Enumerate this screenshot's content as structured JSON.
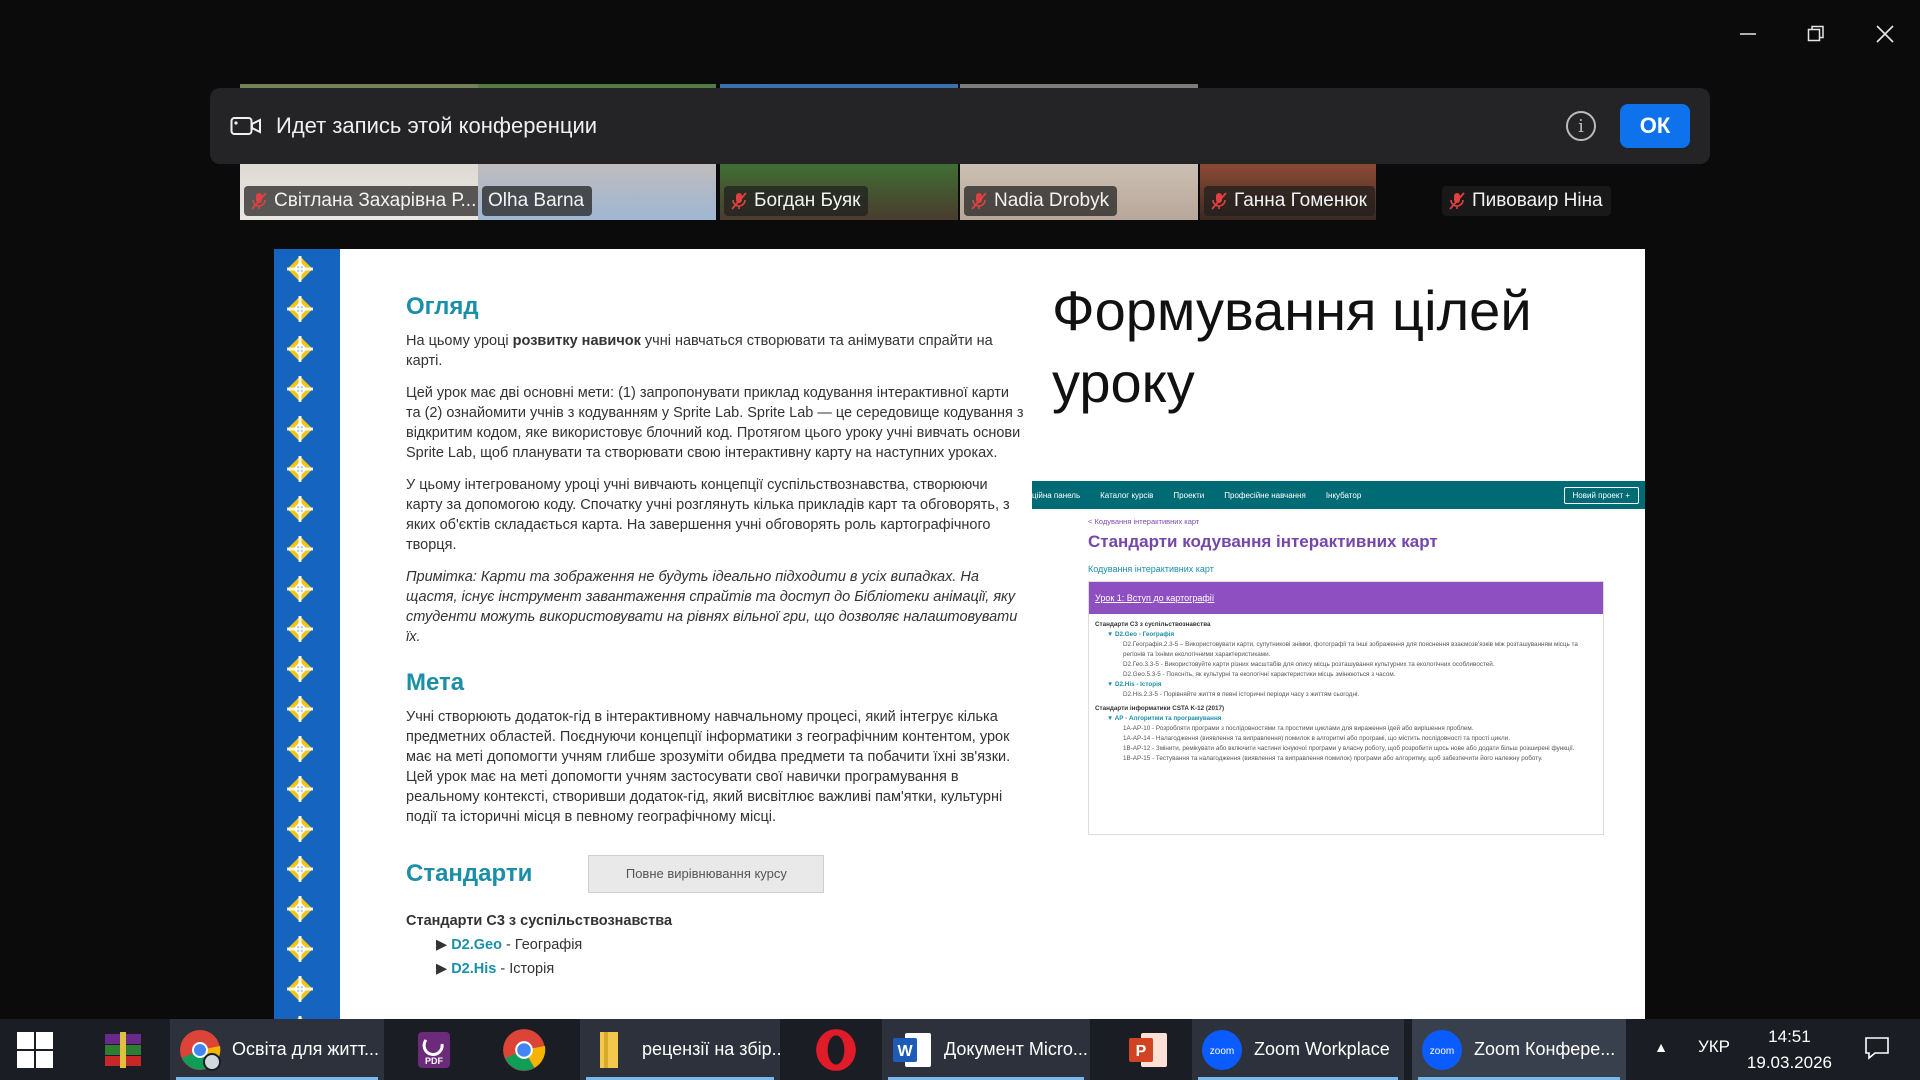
{
  "window": {
    "controls": [
      "minimize-icon",
      "restore-icon",
      "close-icon"
    ]
  },
  "participants": [
    {
      "name": "Світлана Захарівна Р...",
      "muted": true,
      "active": false
    },
    {
      "name": "Olha Barna",
      "muted": false,
      "active": true
    },
    {
      "name": "Богдан Буяк",
      "muted": true,
      "active": false
    },
    {
      "name": "Nadia Drobyk",
      "muted": true,
      "active": false
    },
    {
      "name": "Ганна Гоменюк",
      "muted": true,
      "active": false
    },
    {
      "name": "Пивоваир  Ніна",
      "muted": true,
      "active": false
    }
  ],
  "banner": {
    "text": "Идет запись этой конференции",
    "info_icon": "i",
    "ok_label": "ОК"
  },
  "slide": {
    "title_line1": "Формування цілей",
    "title_line2": "уроку",
    "doc": {
      "overview_heading": "Огляд",
      "overview_p1_a": "На цьому уроці ",
      "overview_p1_b": "розвитку навичок",
      "overview_p1_c": " учні навчаться створювати та анімувати спрайти на карті.",
      "overview_p2": "Цей урок має дві основні мети: (1) запропонувати приклад кодування інтерактивної карти та (2) ознайомити учнів з кодуванням у Sprite Lab. Sprite Lab — це середовище кодування з відкритим кодом, яке використовує блочний код. Протягом цього уроку учні вивчать основи Sprite Lab, щоб планувати та створювати свою інтерактивну карту на наступних уроках.",
      "overview_p3": "У цьому інтегрованому уроці учні вивчають концепції суспільствознавства, створюючи карту за допомогою коду. Спочатку учні розглянуть кілька прикладів карт та обговорять, з яких об'єктів складається карта. На завершення учні обговорять роль картографічного творця.",
      "overview_note": "Примітка: Карти та зображення не будуть ідеально підходити в усіх випадках. На щастя, існує інструмент завантаження спрайтів та доступ до Бібліотеки анімації, яку студенти можуть використовувати на рівнях вільної гри, що дозволяє налаштовувати їх.",
      "goal_heading": "Мета",
      "goal_p": "Учні створюють додаток-гід в інтерактивному навчальному процесі, який інтегрує кілька предметних областей. Поєднуючи концепції інформатики з географічним контентом, урок має на меті допомогти учням глибше зрозуміти обидва предмети та побачити їхні зв'язки. Цей урок має на меті допомогти учням застосувати свої навички програмування в реальному контексті, створивши додаток-гід, який висвітлює важливі пам'ятки, культурні події та історичні місця в певному географічному місці.",
      "standards_heading": "Стандарти",
      "full_alignment_button": "Повне вирівнювання курсу",
      "standards_sub": "Стандарти C3 з суспільствознавства",
      "std_items": [
        {
          "code": "D2.Geo",
          "desc": " - Географія"
        },
        {
          "code": "D2.His",
          "desc": " - Історія"
        }
      ]
    },
    "web": {
      "nav": [
        "ційна панель",
        "Каталог курсів",
        "Проекти",
        "Професійне навчання",
        "Інкубатор"
      ],
      "new_project": "Новий проект  +",
      "crumb": "< Кодування інтерактивних карт",
      "title": "Стандарти кодування інтерактивних карт",
      "subtitle": "Кодування інтерактивних карт",
      "lesson": "Урок 1: Вступ до картографії",
      "l1": "Стандарти C3 з суспільствознавства",
      "l2": "▼ D2.Geo - Географія",
      "l3": "D2.Географія.2.3-5 – Використовувати карти, супутникові знімки, фотографії та інші зображення для пояснення взаємозв'язків між розташуванням місць та регіонів та їхніми екологічними характеристиками.",
      "l4": "D2.Гео.3.3-5 - Використовуйте карти різних масштабів для опису місць розташування культурних та екологічних особливостей.",
      "l5": "D2.Geo.5.3-5 - Поясніть, як культурні та екологічні характеристики місць змінюються з часом.",
      "l6": "▼ D2.His - Історія",
      "l7": "D2.His.2.3-5 - Порівняйте життя в певні історичні періоди часу з життям сьогодні.",
      "l8": "Стандарти інформатики CSTA K-12 (2017)",
      "l9": "▼ AP - Алгоритми та програмування",
      "l10": "1A-AP-10 - Розробляти програми з послідовностями та простими циклами для вираження ідей або вирішення проблем.",
      "l11": "1A-AP-14 - Налагодження (виявлення та виправлення) помилок в алгоритмі або програмі, що містить послідовності та прості цикли.",
      "l12": "1B-AP-12 - Змінити, ремікувати або включити частини існуючої програми у власну роботу, щоб розробити щось нове або додати більш розширені функції.",
      "l13": "1B-AP-15 - Тестування та налагодження (виявлення та виправлення помилок) програми або алгоритму, щоб забезпечити його належну роботу."
    }
  },
  "taskbar": {
    "items": [
      {
        "icon": "windows-start-icon",
        "label": ""
      },
      {
        "icon": "winrar-icon",
        "label": ""
      },
      {
        "icon": "chrome-profile-icon",
        "label": "Освіта для житт..."
      },
      {
        "icon": "pdf-icon",
        "label": ""
      },
      {
        "icon": "chrome-icon",
        "label": ""
      },
      {
        "icon": "folder-icon",
        "label": "рецензії на збір..."
      },
      {
        "icon": "opera-icon",
        "label": ""
      },
      {
        "icon": "word-icon",
        "label": "Документ Micro..."
      },
      {
        "icon": "powerpoint-icon",
        "label": ""
      },
      {
        "icon": "zoom-icon",
        "label": "Zoom Workplace"
      },
      {
        "icon": "zoom-icon",
        "label": "Zoom Конфере..."
      }
    ],
    "lang": "УКР",
    "time": "14:51",
    "date": "19.03.2026"
  },
  "colors": {
    "accent": "#0e72ed",
    "ornament_blue": "#1565c0",
    "ornament_yellow": "#f2c51a",
    "heading_teal": "#1b8ea8",
    "web_purple": "#8e4fc0",
    "web_nav": "#006b74"
  }
}
